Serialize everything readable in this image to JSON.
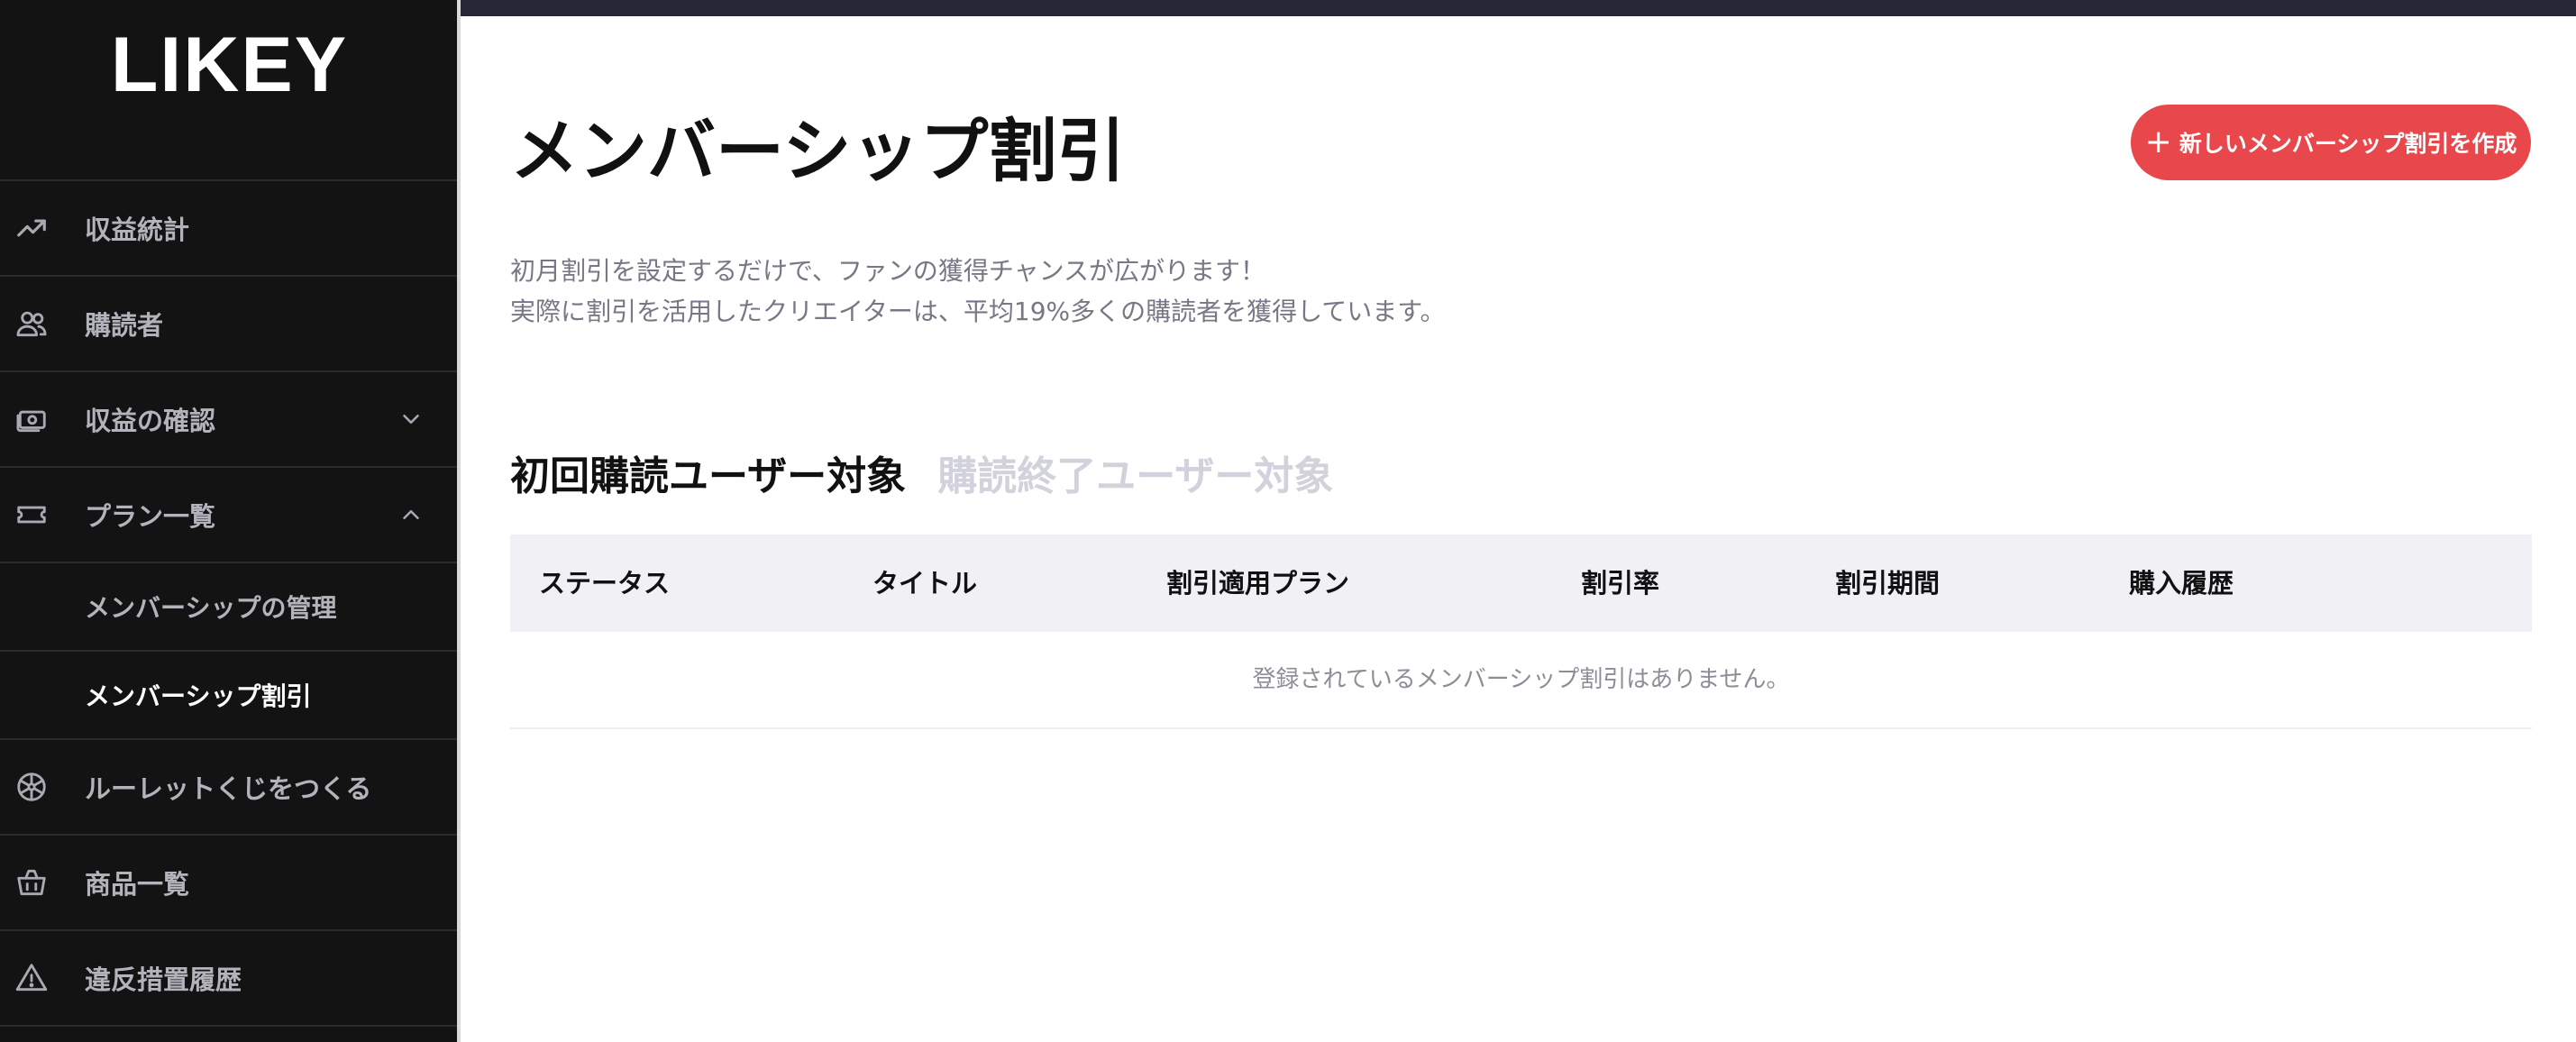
{
  "sidebar": {
    "logo": "LIKEY",
    "items": [
      {
        "label": "収益統計",
        "icon": "trending-up-icon"
      },
      {
        "label": "購読者",
        "icon": "users-icon"
      },
      {
        "label": "収益の確認",
        "icon": "money-icon",
        "chevron": "chevron-down-icon"
      },
      {
        "label": "プラン一覧",
        "icon": "ticket-icon",
        "chevron": "chevron-up-icon"
      },
      {
        "label": "メンバーシップの管理",
        "sub": true
      },
      {
        "label": "メンバーシップ割引",
        "sub": true,
        "active": true
      },
      {
        "label": "ルーレットくじをつくる",
        "icon": "roulette-icon"
      },
      {
        "label": "商品一覧",
        "icon": "basket-icon"
      },
      {
        "label": "違反措置履歴",
        "icon": "warning-icon"
      }
    ]
  },
  "main": {
    "title": "メンバーシップ割引",
    "create_button": {
      "plus": "+",
      "label": "新しいメンバーシップ割引を作成"
    },
    "description": [
      "初月割引を設定するだけで、ファンの獲得チャンスが広がります！",
      "実際に割引を活用したクリエイターは、平均19%多くの購読者を獲得しています。"
    ],
    "tabs": [
      {
        "label": "初回購読ユーザー対象",
        "active": true
      },
      {
        "label": "購読終了ユーザー対象",
        "active": false
      }
    ],
    "table": {
      "columns": [
        "ステータス",
        "タイトル",
        "割引適用プラン",
        "割引率",
        "割引期間",
        "購入履歴"
      ],
      "empty_message": "登録されているメンバーシップ割引はありません。"
    }
  },
  "colors": {
    "sidebar_bg": "#131313",
    "accent": "#e8474b",
    "topbar": "#272738",
    "table_header_bg": "#f0f0f5"
  }
}
